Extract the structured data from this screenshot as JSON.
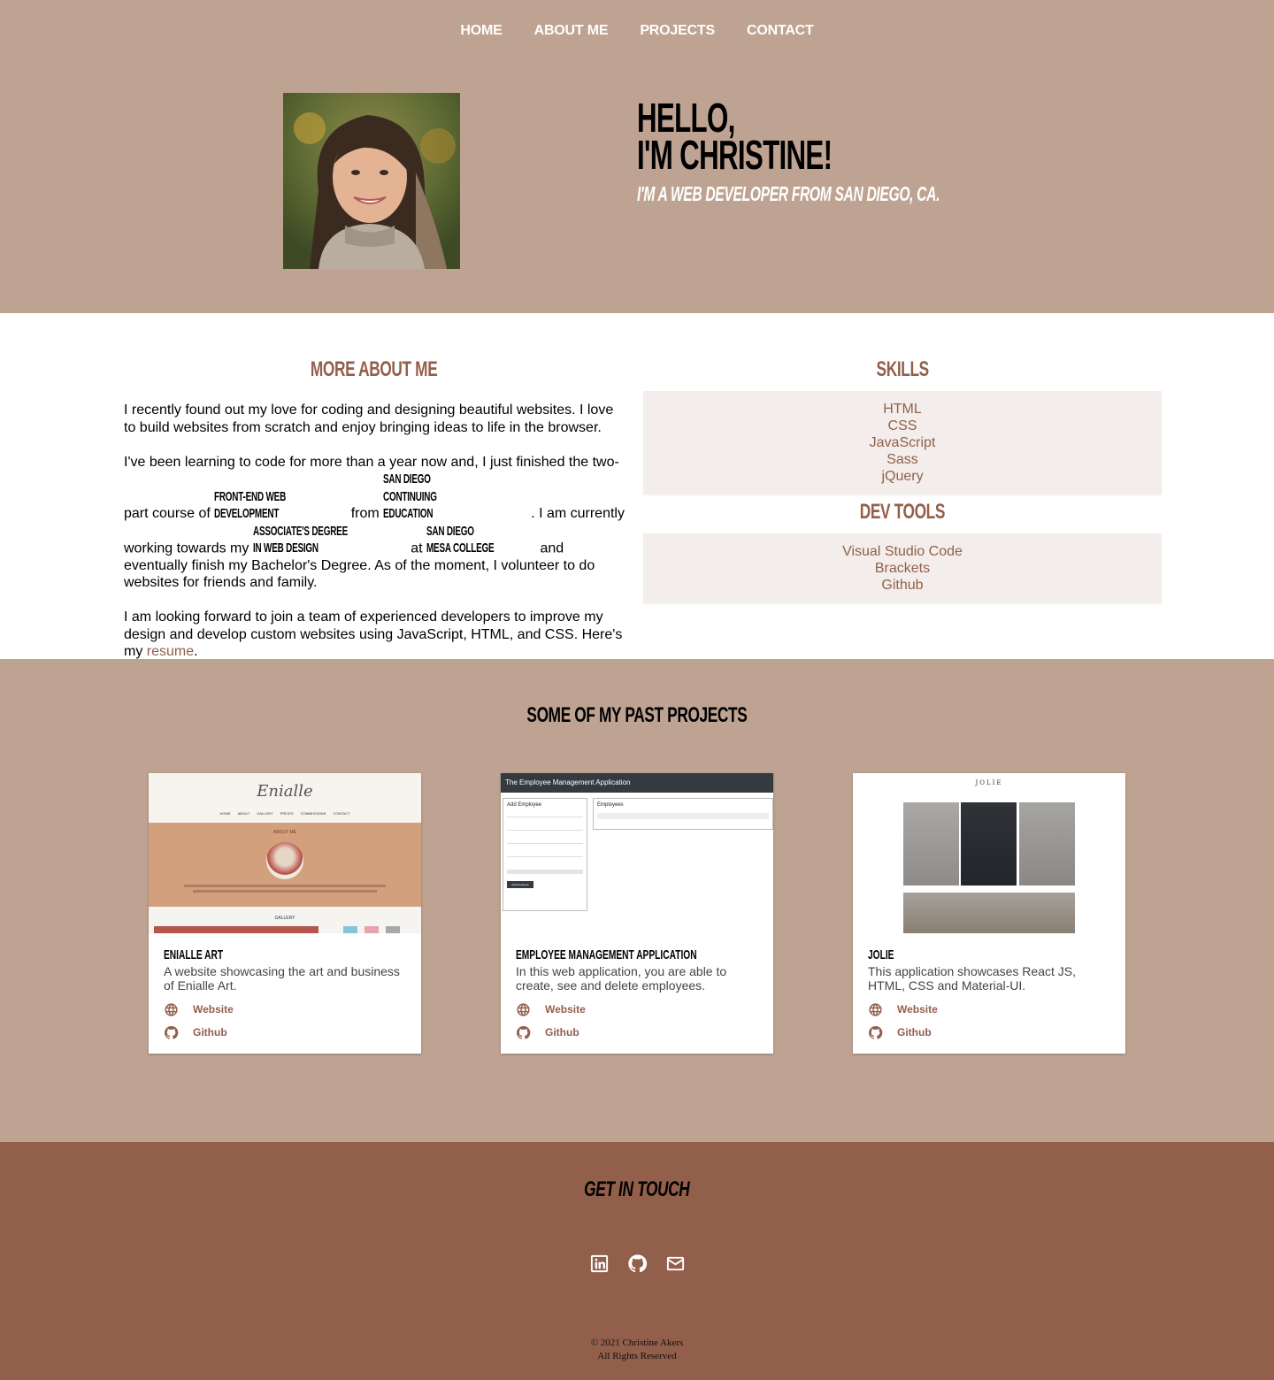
{
  "nav": {
    "items": [
      {
        "label": "HOME"
      },
      {
        "label": "ABOUT ME"
      },
      {
        "label": "PROJECTS"
      },
      {
        "label": "CONTACT"
      }
    ]
  },
  "hero": {
    "line1": "HELLO,",
    "line2": "I'M CHRISTINE!",
    "subtitle": "I'M A WEB DEVELOPER FROM SAN DIEGO, CA."
  },
  "about": {
    "heading": "MORE ABOUT ME",
    "p1": "I recently found out my love for coding and designing beautiful websites. I love to build websites from scratch and enjoy bringing ideas to life in the browser.",
    "p2_a": "I've been learning to code for more than a year now and, I just finished the two-part course of ",
    "p2_em1": "Front-End Web Development",
    "p2_b": " from ",
    "p2_em2": "San Diego Continuing Education",
    "p2_c": ". I am currently working towards my ",
    "p2_em3": "Associate's Degree in Web Design",
    "p2_d": " at ",
    "p2_em4": "San Diego Mesa College",
    "p2_e": " and eventually finish my Bachelor's Degree. As of the moment, I volunteer to do websites for friends and family.",
    "p3_a": "I am looking forward to join a team of experienced developers to improve my design and develop custom websites using JavaScript, HTML, and CSS. Here's my ",
    "p3_link": "resume",
    "p3_b": "."
  },
  "skills": {
    "heading": "SKILLS",
    "items": [
      "HTML",
      "CSS",
      "JavaScript",
      "Sass",
      "jQuery"
    ]
  },
  "devtools": {
    "heading": "DEV TOOLS",
    "items": [
      "Visual Studio Code",
      "Brackets",
      "Github"
    ]
  },
  "projects": {
    "heading": "SOME OF MY PAST PROJECTS",
    "cards": [
      {
        "title": "ENIALLE ART",
        "desc": "A website showcasing the art and business of Enialle Art.",
        "website_label": "Website",
        "github_label": "Github",
        "thumb": {
          "logo": "Enialle",
          "menu": [
            "HOME",
            "ABOUT",
            "GALLERY",
            "PRICES",
            "COMMISSIONS",
            "CONTACT"
          ],
          "section": "ABOUT ME",
          "gallery": "GALLERY"
        }
      },
      {
        "title": "EMPLOYEE MANAGEMENT APPLICATION",
        "desc": "In this web application, you are able to create, see and delete employees.",
        "website_label": "Website",
        "github_label": "Github",
        "thumb": {
          "bar": "The Employee Management Application",
          "add": "Add Employee",
          "list": "Employees",
          "button": "Add Employee"
        }
      },
      {
        "title": "JOLIE",
        "desc": "This application showcases React JS, HTML, CSS and Material-UI.",
        "website_label": "Website",
        "github_label": "Github",
        "thumb": {
          "brand": "JOLIE"
        }
      }
    ]
  },
  "footer": {
    "heading": "GET IN TOUCH",
    "socials": [
      "linkedin-icon",
      "github-icon",
      "mail-icon"
    ],
    "copyright1": "© 2021 Christine Akers",
    "copyright2": "All Rights Reserved"
  },
  "colors": {
    "header_bg": "#bfa392",
    "accent": "#935f4b",
    "footer_bg": "#925f4b",
    "skill_box": "#f3eeeb"
  }
}
